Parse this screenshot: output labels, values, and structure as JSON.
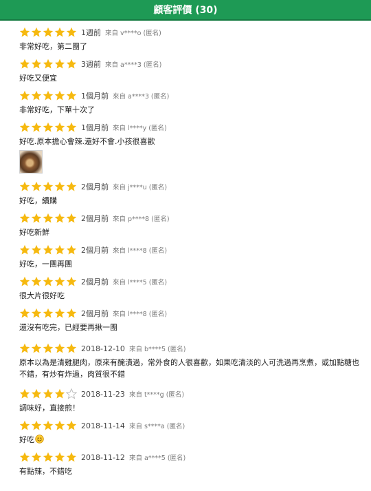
{
  "header": {
    "title": "顧客評價 (30)"
  },
  "colors": {
    "header_bg": "#1e9a55",
    "star_full": "#f6b90f",
    "star_empty": "#bdbdbd"
  },
  "from_label": "來自",
  "reviews": [
    {
      "rating": 5,
      "time": "1週前",
      "user": "v****o (匿名)",
      "content": "非常好吃，第二團了"
    },
    {
      "rating": 5,
      "time": "3週前",
      "user": "a****3 (匿名)",
      "content": "好吃又便宜"
    },
    {
      "rating": 5,
      "time": "1個月前",
      "user": "a****3 (匿名)",
      "content": "非常好吃，下單十次了"
    },
    {
      "rating": 5,
      "time": "1個月前",
      "user": "l****y (匿名)",
      "content": "好吃.原本擔心會辣.還好不會.小孩很喜歡",
      "has_photo": true
    },
    {
      "rating": 5,
      "time": "2個月前",
      "user": "j****u (匿名)",
      "content": "好吃，續購"
    },
    {
      "rating": 5,
      "time": "2個月前",
      "user": "p****8 (匿名)",
      "content": "好吃新鮮"
    },
    {
      "rating": 5,
      "time": "2個月前",
      "user": "l****8 (匿名)",
      "content": "好吃，一團再團"
    },
    {
      "rating": 5,
      "time": "2個月前",
      "user": "l****5 (匿名)",
      "content": "很大片很好吃"
    },
    {
      "rating": 5,
      "time": "2個月前",
      "user": "l****8 (匿名)",
      "content": "還沒有吃完，已經要再揪一團"
    },
    {
      "rating": 5,
      "time": "2018-12-10",
      "user": "b****5 (匿名)",
      "content": "原本以為是清雞腿肉，原來有醃漬過，常外食的人很喜歡，如果吃清淡的人可洗過再烹煮，或加點糖也不錯，有炒有炸過，肉質很不錯"
    },
    {
      "rating": 4,
      "time": "2018-11-23",
      "user": "t****g (匿名)",
      "content": "調味好，直接煎！"
    },
    {
      "rating": 5,
      "time": "2018-11-14",
      "user": "s****a (匿名)",
      "content": "好吃",
      "emoji": "smiling-face-icon"
    },
    {
      "rating": 5,
      "time": "2018-11-12",
      "user": "a****5 (匿名)",
      "content": "有點辣，不錯吃"
    }
  ]
}
